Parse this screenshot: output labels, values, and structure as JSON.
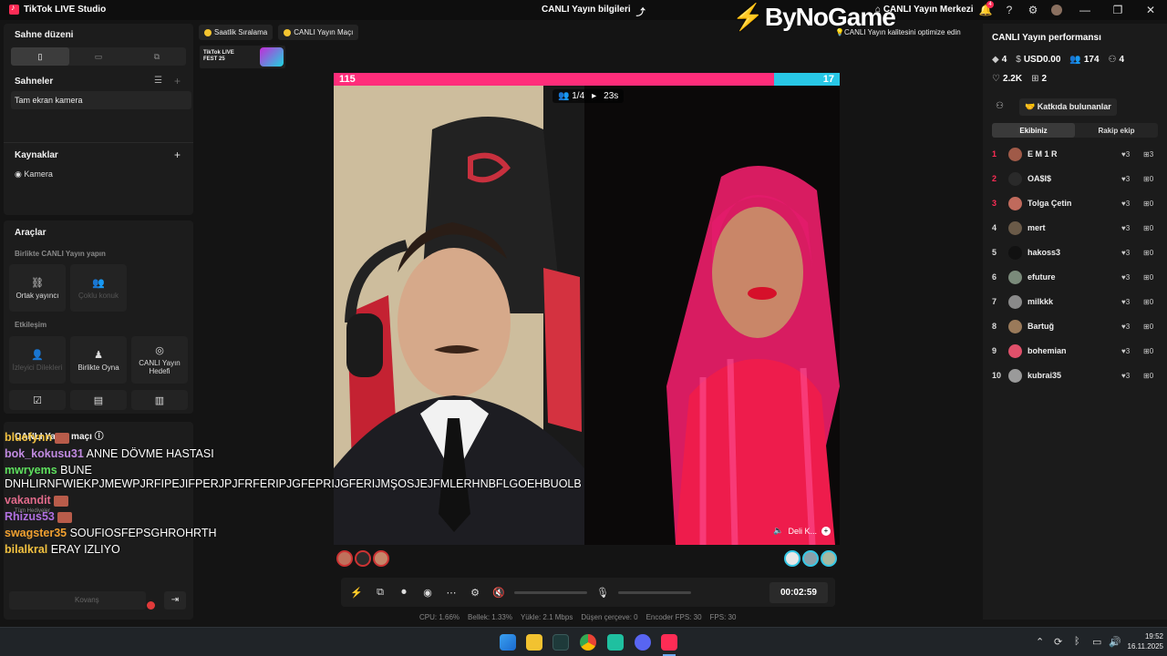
{
  "titlebar": {
    "app_name": "TikTok LIVE Studio",
    "center_title": "CANLI Yayın bilgileri",
    "live_center": "CANLI Yayın Merkezi",
    "notification_count": "4",
    "watermark": "ByNoGame"
  },
  "left": {
    "scene_layout_title": "Sahne düzeni",
    "scenes_title": "Sahneler",
    "scene_item": "Tam ekran kamera",
    "sources_title": "Kaynaklar",
    "source_item": "Kamera",
    "tools_title": "Araçlar",
    "collab_title": "Birlikte CANLI Yayın yapın",
    "tool_cohost": "Ortak yayıncı",
    "tool_multi": "Çoklu konuk",
    "interaction_title": "Etkileşim",
    "tool_viewer_wishes": "İzleyici Dilekleri",
    "tool_play": "Birlikte Oyna",
    "tool_goal": "CANLI Yayın Hedefi",
    "live_match_title": "CANLI Yayın maçı",
    "gift_hint": "Tüm Hediyeler",
    "bottom_input": "Kovanş"
  },
  "chips": {
    "ranking": "Saatlik Sıralama",
    "match": "CANLI Yayın Maçı",
    "livefest": "TikTok LIVE FEST 25",
    "optimize_hint": "CANLI Yayın kalitesini optimize edin"
  },
  "stage": {
    "score_left": "115",
    "score_right": "17",
    "left_share": 0.871,
    "round": "1/4",
    "countdown": "23s",
    "opponent_label": "Deli K..."
  },
  "controls": {
    "timer": "00:02:59"
  },
  "stats": {
    "cpu": "CPU: 1.66%",
    "memory": "Bellek: 1.33%",
    "upload": "Yükle: 2.1 Mbps",
    "dropped": "Düşen çerçeve: 0",
    "encoder_fps": "Encoder FPS: 30",
    "fps": "FPS: 30"
  },
  "performance": {
    "title": "CANLI Yayın performansı",
    "diamonds": "4",
    "usd": "USD0.00",
    "viewers": "174",
    "new_followers": "4",
    "likes": "2.2K",
    "gifters": "2",
    "contributors_button": "Katkıda bulunanlar",
    "tab_ours": "Ekibiniz",
    "tab_rival": "Rakip ekip",
    "leaderboard": [
      {
        "rank": "1",
        "name": "E M 1 R",
        "hearts": "3",
        "gifts": "3",
        "color": "#a05a48"
      },
      {
        "rank": "2",
        "name": "OA$I$",
        "hearts": "3",
        "gifts": "0",
        "color": "#2a2a2a"
      },
      {
        "rank": "3",
        "name": "Tolga Çetin",
        "hearts": "3",
        "gifts": "0",
        "color": "#c06a5c"
      },
      {
        "rank": "4",
        "name": "mert",
        "hearts": "3",
        "gifts": "0",
        "color": "#6a5a48"
      },
      {
        "rank": "5",
        "name": "hakoss3",
        "hearts": "3",
        "gifts": "0",
        "color": "#111111"
      },
      {
        "rank": "6",
        "name": "efuture",
        "hearts": "3",
        "gifts": "0",
        "color": "#7a8a7a"
      },
      {
        "rank": "7",
        "name": "milkkk",
        "hearts": "3",
        "gifts": "0",
        "color": "#8a8a8a"
      },
      {
        "rank": "8",
        "name": "Bartuğ",
        "hearts": "3",
        "gifts": "0",
        "color": "#9a7a5a"
      },
      {
        "rank": "9",
        "name": "bohemian",
        "hearts": "3",
        "gifts": "0",
        "color": "#e0506a"
      },
      {
        "rank": "10",
        "name": "kubrai35",
        "hearts": "3",
        "gifts": "0",
        "color": "#9a9a9a"
      }
    ]
  },
  "chat": [
    {
      "user": "bluefynn",
      "msg": "",
      "color": "#f0c040"
    },
    {
      "user": "bok_kokusu31",
      "msg": "ANNE DÖVME HASTASI",
      "color": "#c08ae0"
    },
    {
      "user": "mwryems",
      "msg": "BUNE DNHLIRNFWIEKPJMEWPJRFIPEJIFPERJPJFRFERIPJGFEPRIJGFERIJMŞOSJEJFMLERHNBFLGOEHBUOLB",
      "color": "#5ee05e"
    },
    {
      "user": "vakandit",
      "msg": "",
      "color": "#e06a8a"
    },
    {
      "user": "Rhizus53",
      "msg": "",
      "color": "#b070e0"
    },
    {
      "user": "swagster35",
      "msg": "SOUFIOSFEPSGHROHRTH",
      "color": "#f0a030"
    },
    {
      "user": "bilalkral",
      "msg": "ERAY IZLIYO",
      "color": "#f0c040"
    }
  ],
  "taskbar": {
    "time": "19:52",
    "date": "16.11.2025"
  }
}
